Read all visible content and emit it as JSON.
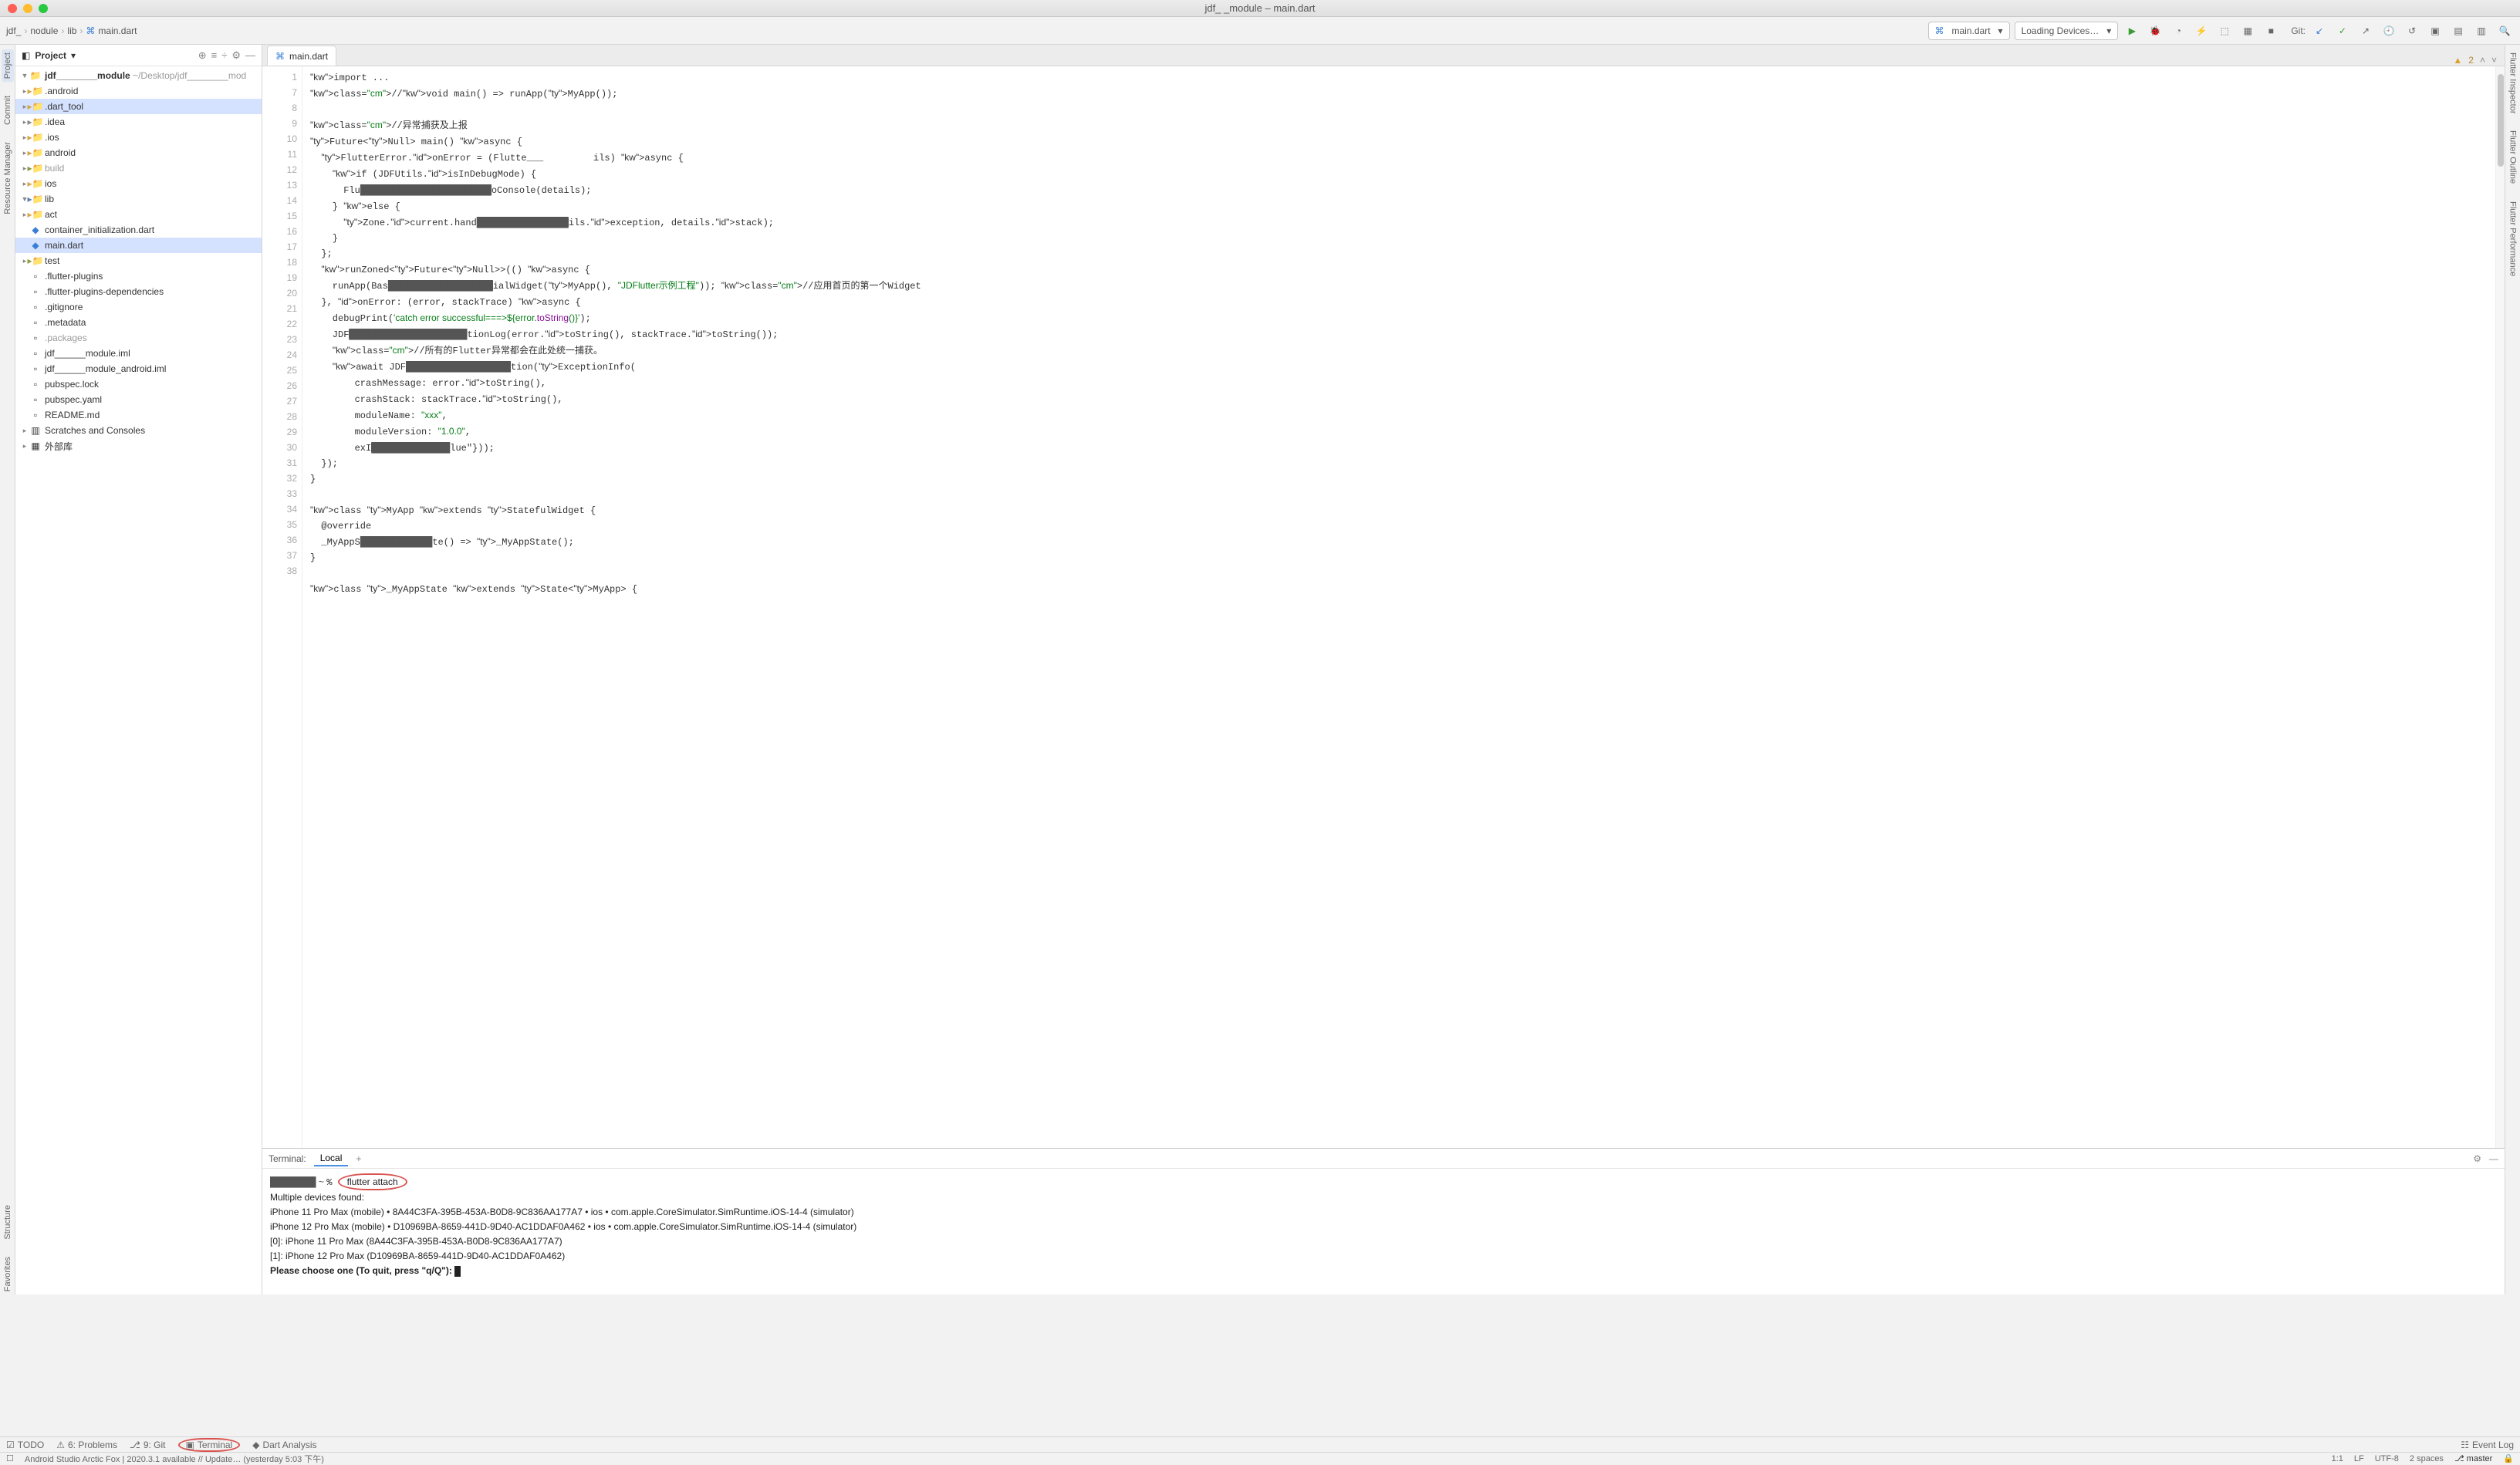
{
  "window": {
    "title": "jdf_       _module – main.dart"
  },
  "breadcrumb": {
    "a": "jdf_",
    "b": "nodule",
    "c": "lib",
    "d": "main.dart"
  },
  "runconfig": {
    "label": "main.dart"
  },
  "devices": {
    "label": "Loading Devices…"
  },
  "git": {
    "label": "Git:"
  },
  "projectPanel": {
    "title": "Project"
  },
  "tree": {
    "rootName": "jdf________module",
    "rootPath": "~/Desktop/jdf________mod",
    "items": [
      {
        "name": ".android",
        "type": "folder-orange",
        "indent": 1
      },
      {
        "name": ".dart_tool",
        "type": "folder-orange",
        "indent": 1,
        "sel": true
      },
      {
        "name": ".idea",
        "type": "folder-gray",
        "indent": 1
      },
      {
        "name": ".ios",
        "type": "folder-orange",
        "indent": 1
      },
      {
        "name": "android",
        "type": "folder-orange",
        "indent": 1
      },
      {
        "name": "build",
        "type": "folder-green",
        "indent": 1,
        "muted": true
      },
      {
        "name": "ios",
        "type": "folder-orange",
        "indent": 1
      },
      {
        "name": "lib",
        "type": "folder-blue",
        "indent": 1,
        "open": true
      },
      {
        "name": "act",
        "type": "folder-orange",
        "indent": 2
      },
      {
        "name": "container_initialization.dart",
        "type": "file-dart",
        "indent": 2
      },
      {
        "name": "main.dart",
        "type": "file-dart",
        "indent": 2,
        "sel": true
      },
      {
        "name": "test",
        "type": "folder-green",
        "indent": 1
      },
      {
        "name": ".flutter-plugins",
        "type": "file",
        "indent": 1
      },
      {
        "name": ".flutter-plugins-dependencies",
        "type": "file",
        "indent": 1
      },
      {
        "name": ".gitignore",
        "type": "file",
        "indent": 1
      },
      {
        "name": ".metadata",
        "type": "file",
        "indent": 1
      },
      {
        "name": ".packages",
        "type": "file",
        "indent": 1,
        "muted": true
      },
      {
        "name": "jdf______module.iml",
        "type": "file",
        "indent": 1
      },
      {
        "name": "jdf______module_android.iml",
        "type": "file",
        "indent": 1
      },
      {
        "name": "pubspec.lock",
        "type": "file",
        "indent": 1
      },
      {
        "name": "pubspec.yaml",
        "type": "file",
        "indent": 1
      },
      {
        "name": "README.md",
        "type": "file",
        "indent": 1
      }
    ],
    "scratches": "Scratches and Consoles",
    "extlib": "外部库"
  },
  "editor": {
    "tab": "main.dart",
    "warnCount": "2",
    "gutterStart": 1,
    "lines": [
      "import ...",
      "//void main() => runApp(MyApp());",
      "",
      "//异常捕获及上报",
      "Future<Null> main() async {",
      "  FlutterError.onError = (Flutte___         ils) async {",
      "    if (JDFUtils.isInDebugMode) {",
      "      Flu████████████████████oConsole(details);",
      "    } else {",
      "      Zone.current.hand██████████████ils.exception, details.stack);",
      "    }",
      "  };",
      "  runZoned<Future<Null>>(() async {",
      "    runApp(Bas████████████████ialWidget(MyApp(), \"JDFlutter示例工程\")); //应用首页的第一个Widget",
      "  }, onError: (error, stackTrace) async {",
      "    debugPrint('catch error successful===>${error.toString()}');",
      "    JDF██████████████████tionLog(error.toString(), stackTrace.toString());",
      "    //所有的Flutter异常都会在此处统一捕获。",
      "    await JDF████████████████tion(ExceptionInfo(",
      "        crashMessage: error.toString(),",
      "        crashStack: stackTrace.toString(),",
      "        moduleName: \"xxx\",",
      "        moduleVersion: \"1.0.0\",",
      "        exI████████████lue\"}));",
      "  });",
      "}",
      "",
      "class MyApp extends StatefulWidget {",
      "  @override",
      "  _MyAppS███████████te() => _MyAppState();",
      "}",
      "",
      "class _MyAppState extends State<MyApp> {"
    ],
    "lineNumbers": [
      "1",
      "7",
      "8",
      "9",
      "10",
      "11",
      "12",
      "13",
      "14",
      "15",
      "16",
      "17",
      "18",
      "19",
      "20",
      "21",
      "22",
      "23",
      "24",
      "25",
      "26",
      "27",
      "28",
      "29",
      "30",
      "31",
      "32",
      "33",
      "34",
      "35",
      "36",
      "37",
      "38"
    ]
  },
  "terminal": {
    "title": "Terminal:",
    "tabLocal": "Local",
    "cmd": "flutter attach",
    "lines": [
      "Multiple devices found:",
      "iPhone 11 Pro Max (mobile) • 8A44C3FA-395B-453A-B0D8-9C836AA177A7 • ios • com.apple.CoreSimulator.SimRuntime.iOS-14-4 (simulator)",
      "iPhone 12 Pro Max (mobile) • D10969BA-8659-441D-9D40-AC1DDAF0A462 • ios • com.apple.CoreSimulator.SimRuntime.iOS-14-4 (simulator)",
      "[0]: iPhone 11 Pro Max (8A44C3FA-395B-453A-B0D8-9C836AA177A7)",
      "[1]: iPhone 12 Pro Max (D10969BA-8659-441D-9D40-AC1DDAF0A462)",
      "Please choose one (To quit, press \"q/Q\"): "
    ]
  },
  "bottomTabs": {
    "todo": "TODO",
    "problems": "6: Problems",
    "git": "9: Git",
    "terminal": "Terminal",
    "dart": "Dart Analysis",
    "eventlog": "Event Log"
  },
  "status": {
    "msg": "Android Studio Arctic Fox | 2020.3.1 available // Update… (yesterday 5:03 下午)",
    "pos": "1:1",
    "enc": "LF",
    "charset": "UTF-8",
    "indent": "2 spaces",
    "branch": "master"
  },
  "leftTabs": {
    "project": "Project",
    "commit": "Commit",
    "rm": "Resource Manager",
    "structure": "Structure",
    "fav": "Favorites"
  },
  "rightTabs": {
    "insp": "Flutter Inspector",
    "outline": "Flutter Outline",
    "perf": "Flutter Performance"
  }
}
